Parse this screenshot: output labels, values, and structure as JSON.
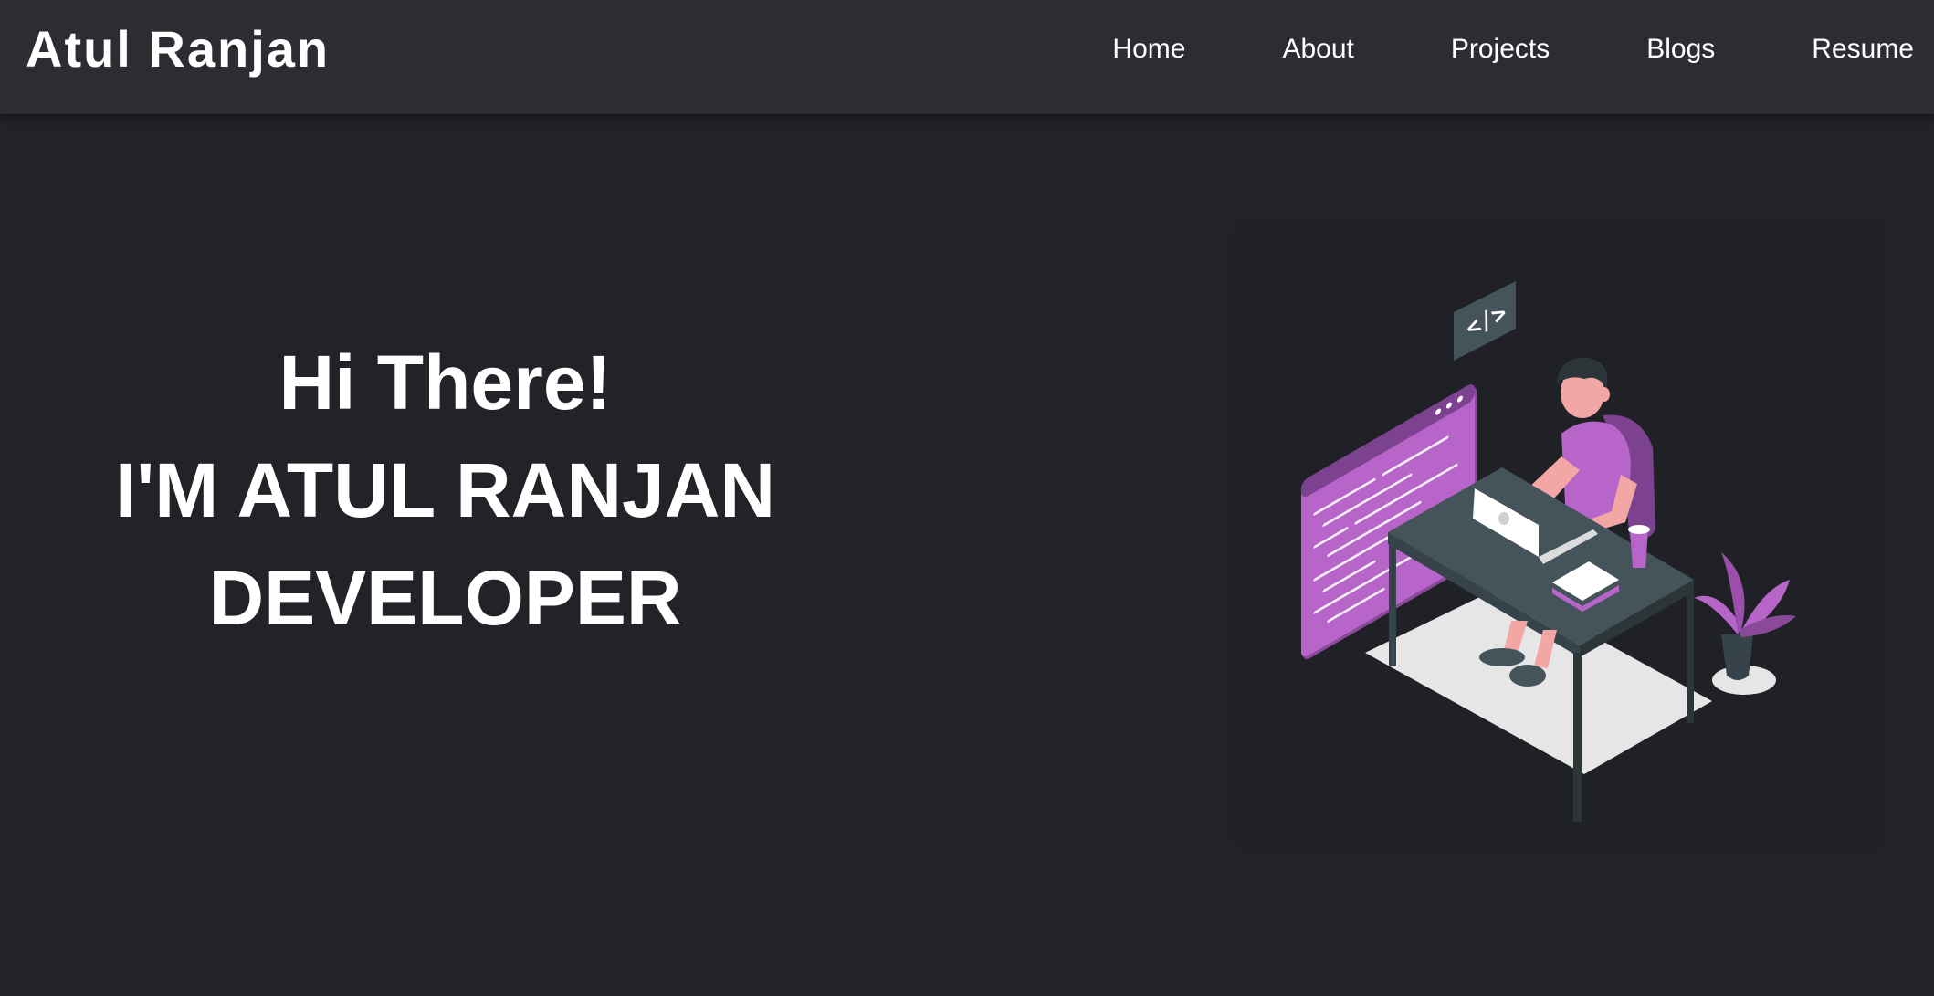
{
  "header": {
    "brand": "Atul Ranjan",
    "nav": [
      {
        "label": "Home"
      },
      {
        "label": "About"
      },
      {
        "label": "Projects"
      },
      {
        "label": "Blogs"
      },
      {
        "label": "Resume"
      }
    ]
  },
  "hero": {
    "greeting": "Hi There!",
    "name_line": "I'M ATUL RANJAN",
    "role": "DEVELOPER"
  },
  "illustration": {
    "icon": "developer-at-desk-illustration",
    "code_tag": "</>",
    "accent": "#b765c9",
    "desk_color": "#45535b",
    "floor_color": "#e6e6e6"
  },
  "colors": {
    "page_bg": "#212328",
    "nav_bg": "#2c2d32",
    "text": "#ffffff"
  }
}
